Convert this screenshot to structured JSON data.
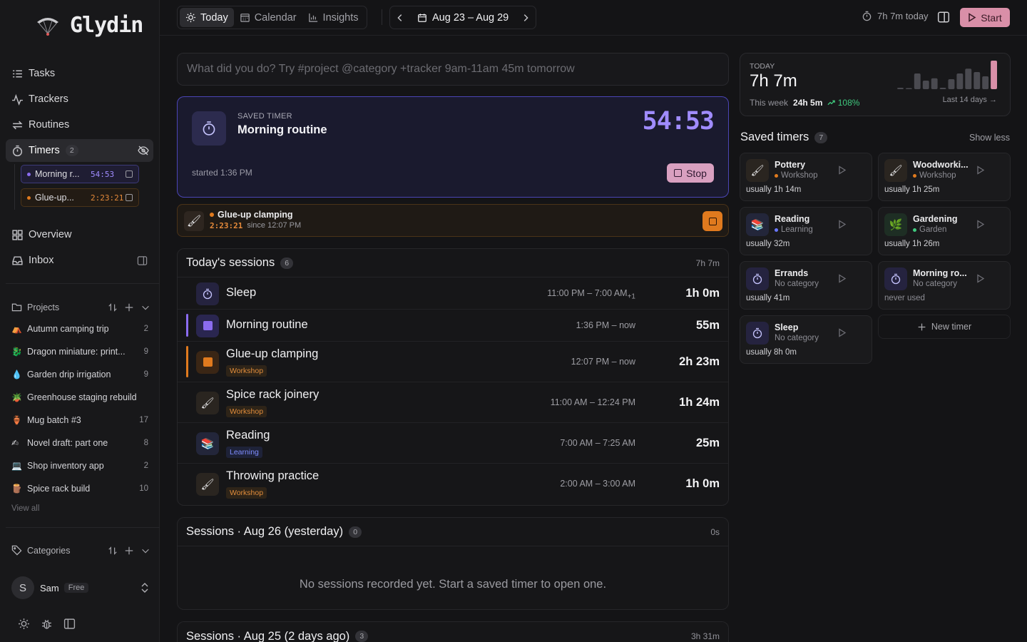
{
  "app": {
    "name": "Glydin"
  },
  "nav": {
    "tasks": "Tasks",
    "trackers": "Trackers",
    "routines": "Routines",
    "timers": "Timers",
    "timers_count": "2",
    "overview": "Overview",
    "inbox": "Inbox"
  },
  "sidebar_timers": [
    {
      "name": "Morning r...",
      "time": "54:53",
      "color": "#8b6cf0"
    },
    {
      "name": "Glue-up...",
      "time": "2:23:21",
      "color": "#e07a1e"
    }
  ],
  "projects": {
    "title": "Projects",
    "view_all": "View all",
    "items": [
      {
        "emoji": "⛺",
        "name": "Autumn camping trip",
        "count": "2"
      },
      {
        "emoji": "🐉",
        "name": "Dragon miniature: print...",
        "count": "9"
      },
      {
        "emoji": "💧",
        "name": "Garden drip irrigation",
        "count": "9"
      },
      {
        "emoji": "🪴",
        "name": "Greenhouse staging rebuild",
        "count": ""
      },
      {
        "emoji": "🏺",
        "name": "Mug batch #3",
        "count": "17"
      },
      {
        "emoji": "✍",
        "name": "Novel draft: part one",
        "count": "8"
      },
      {
        "emoji": "💻",
        "name": "Shop inventory app",
        "count": "2"
      },
      {
        "emoji": "🪵",
        "name": "Spice rack build",
        "count": "10"
      }
    ]
  },
  "categories": {
    "title": "Categories"
  },
  "user": {
    "initial": "S",
    "name": "Sam",
    "plan": "Free"
  },
  "topbar": {
    "tab_today": "Today",
    "tab_calendar": "Calendar",
    "tab_insights": "Insights",
    "date_range": "Aug 23 – Aug 29",
    "today_total": "7h 7m today",
    "start_label": "Start"
  },
  "quick_entry": {
    "placeholder": "What did you do? Try #project @category +tracker 9am-11am 45m tomorrow"
  },
  "running_timer": {
    "label": "SAVED TIMER",
    "name": "Morning routine",
    "elapsed": "54:53",
    "started": "started 1:36 PM",
    "stop_label": "Stop"
  },
  "second_timer": {
    "icon": "🖌",
    "name": "Glue-up clamping",
    "elapsed": "2:23:21",
    "since": "since 12:07 PM"
  },
  "todays_sessions": {
    "title": "Today's sessions",
    "count": "6",
    "total": "7h 7m",
    "rows": [
      {
        "name": "Sleep",
        "start": "11:00 PM",
        "end": "7:00 AM",
        "plus": "+1",
        "duration": "1h 0m",
        "tag": ""
      },
      {
        "name": "Morning routine",
        "start": "1:36 PM",
        "end": "now",
        "plus": "",
        "duration": "55m",
        "tag": ""
      },
      {
        "name": "Glue-up clamping",
        "start": "12:07 PM",
        "end": "now",
        "plus": "",
        "duration": "2h 23m",
        "tag": "Workshop"
      },
      {
        "name": "Spice rack joinery",
        "start": "11:00 AM",
        "end": "12:24 PM",
        "plus": "",
        "duration": "1h 24m",
        "tag": "Workshop"
      },
      {
        "name": "Reading",
        "start": "7:00 AM",
        "end": "7:25 AM",
        "plus": "",
        "duration": "25m",
        "tag": "Learning"
      },
      {
        "name": "Throwing practice",
        "start": "2:00 AM",
        "end": "3:00 AM",
        "plus": "",
        "duration": "1h 0m",
        "tag": "Workshop"
      }
    ]
  },
  "yesterday": {
    "title": "Sessions · Aug 26 (yesterday)",
    "count": "0",
    "total": "0s",
    "empty": "No sessions recorded yet. Start a saved timer to open one."
  },
  "two_days_ago": {
    "title": "Sessions · Aug 25 (2 days ago)",
    "count": "3",
    "total": "3h 31m"
  },
  "today_card": {
    "label": "TODAY",
    "value": "7h 7m",
    "week_label": "This week",
    "week_value": "24h 5m",
    "week_change": "108%",
    "range_label": "Last 14 days",
    "sparkline": [
      0.05,
      0.02,
      0.55,
      0.3,
      0.38,
      0.05,
      0.35,
      0.55,
      0.72,
      0.6,
      0.45,
      1.0
    ]
  },
  "saved_timers": {
    "title": "Saved timers",
    "count": "7",
    "show_less": "Show less",
    "new_timer": "New timer",
    "items": [
      {
        "icon": "🖌",
        "name": "Pottery",
        "category": "Workshop",
        "dot": "#e07a1e",
        "usually": "usually 1h 14m"
      },
      {
        "icon": "🖌",
        "name": "Woodworki...",
        "category": "Workshop",
        "dot": "#e07a1e",
        "usually": "usually 1h 25m"
      },
      {
        "icon": "📚",
        "name": "Reading",
        "category": "Learning",
        "dot": "#6a78ff",
        "usually": "usually 32m"
      },
      {
        "icon": "🌿",
        "name": "Gardening",
        "category": "Garden",
        "dot": "#3fc97e",
        "usually": "usually 1h 26m"
      },
      {
        "icon": "⏱",
        "name": "Errands",
        "category": "No category",
        "dot": "",
        "usually": "usually 41m"
      },
      {
        "icon": "⏱",
        "name": "Morning ro...",
        "category": "No category",
        "dot": "",
        "usually": "never used"
      },
      {
        "icon": "⏱",
        "name": "Sleep",
        "category": "No category",
        "dot": "",
        "usually": "usually 8h 0m"
      }
    ]
  }
}
